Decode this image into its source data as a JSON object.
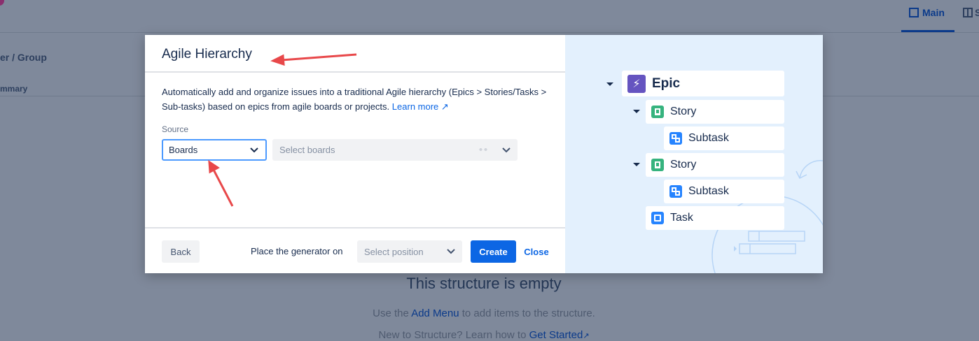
{
  "background": {
    "breadcrumb": "er / Group",
    "column": "mmary",
    "tabs": [
      {
        "label": "Main",
        "active": true
      },
      {
        "label": "S",
        "active": false
      }
    ],
    "empty_title": "This structure is empty",
    "empty_line1_pre": "Use the ",
    "empty_line1_link": "Add Menu",
    "empty_line1_post": " to add items to the structure.",
    "empty_line2_pre": "New to Structure? Learn how to ",
    "empty_line2_link": "Get Started",
    "external_glyph": "↗"
  },
  "dialog": {
    "title": "Agile Hierarchy",
    "description": "Automatically add and organize issues into a traditional Agile hierarchy (Epics > Stories/Tasks > Sub-tasks) based on epics from agile boards or projects.",
    "learn_more": "Learn more",
    "source_label": "Source",
    "source_value": "Boards",
    "boards_placeholder": "Select boards",
    "back": "Back",
    "place_label": "Place the generator on",
    "position_placeholder": "Select position",
    "create": "Create",
    "close": "Close"
  },
  "preview": {
    "items": [
      {
        "label": "Epic",
        "type": "epic",
        "color": "#6554c0"
      },
      {
        "label": "Story",
        "type": "story",
        "color": "#36b37e"
      },
      {
        "label": "Subtask",
        "type": "subtask",
        "color": "#2684ff"
      },
      {
        "label": "Story",
        "type": "story",
        "color": "#36b37e"
      },
      {
        "label": "Subtask",
        "type": "subtask",
        "color": "#2684ff"
      },
      {
        "label": "Task",
        "type": "task",
        "color": "#2684ff"
      }
    ]
  },
  "colors": {
    "accent": "#0c66e4",
    "annotation": "#e8484a"
  }
}
